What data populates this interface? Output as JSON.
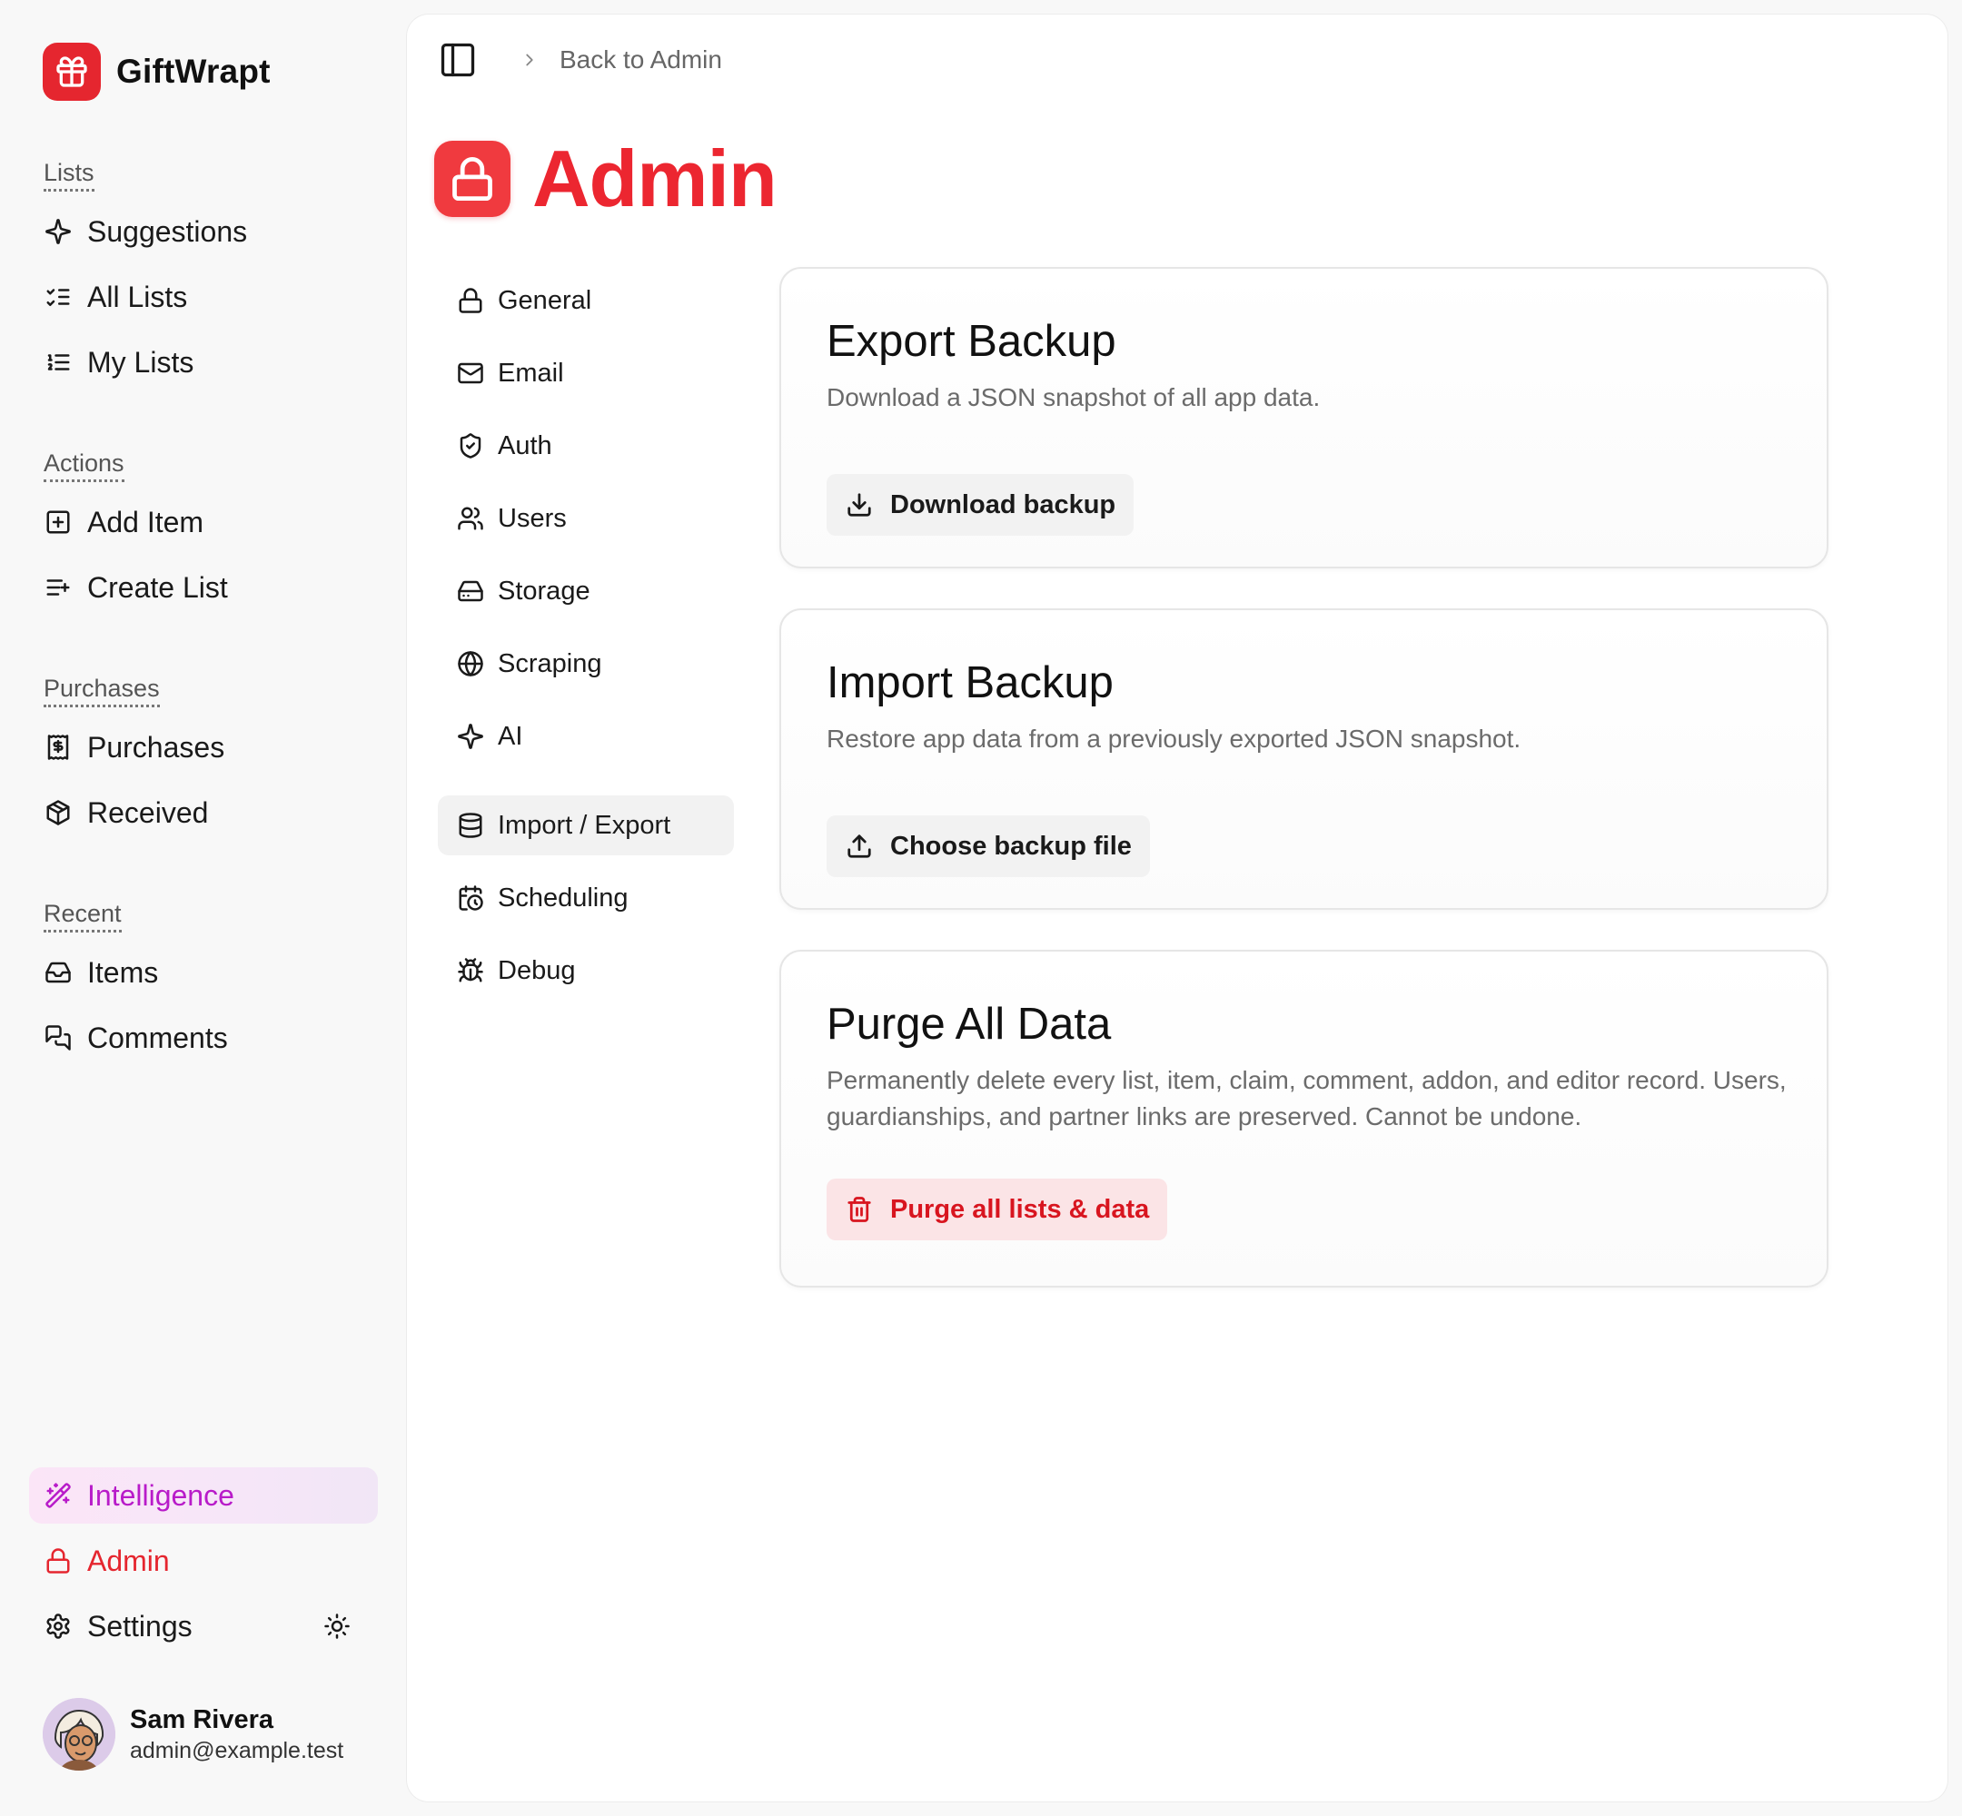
{
  "brand": {
    "name": "GiftWrapt"
  },
  "sidebar": {
    "sections": [
      {
        "label": "Lists",
        "items": [
          {
            "label": "Suggestions",
            "icon": "sparkles-icon"
          },
          {
            "label": "All Lists",
            "icon": "list-checks-icon"
          },
          {
            "label": "My Lists",
            "icon": "list-ordered-icon"
          }
        ]
      },
      {
        "label": "Actions",
        "items": [
          {
            "label": "Add Item",
            "icon": "square-plus-icon"
          },
          {
            "label": "Create List",
            "icon": "list-plus-icon"
          }
        ]
      },
      {
        "label": "Purchases",
        "items": [
          {
            "label": "Purchases",
            "icon": "receipt-icon"
          },
          {
            "label": "Received",
            "icon": "package-icon"
          }
        ]
      },
      {
        "label": "Recent",
        "items": [
          {
            "label": "Items",
            "icon": "inbox-icon"
          },
          {
            "label": "Comments",
            "icon": "messages-icon"
          }
        ]
      }
    ],
    "bottom": {
      "intelligence": "Intelligence",
      "admin": "Admin",
      "settings": "Settings"
    },
    "user": {
      "name": "Sam Rivera",
      "email": "admin@example.test"
    }
  },
  "topbar": {
    "back_label": "Back to Admin"
  },
  "page": {
    "title": "Admin"
  },
  "subnav": {
    "items": [
      {
        "label": "General",
        "icon": "lock-icon"
      },
      {
        "label": "Email",
        "icon": "mail-icon"
      },
      {
        "label": "Auth",
        "icon": "shield-check-icon"
      },
      {
        "label": "Users",
        "icon": "users-icon"
      },
      {
        "label": "Storage",
        "icon": "hard-drive-icon"
      },
      {
        "label": "Scraping",
        "icon": "globe-icon"
      },
      {
        "label": "AI",
        "icon": "sparkles-icon"
      },
      {
        "label": "Import / Export",
        "icon": "database-icon",
        "active": true
      },
      {
        "label": "Scheduling",
        "icon": "calendar-clock-icon"
      },
      {
        "label": "Debug",
        "icon": "bug-icon"
      }
    ]
  },
  "cards": {
    "export": {
      "title": "Export Backup",
      "description": "Download a JSON snapshot of all app data.",
      "button": "Download backup"
    },
    "import": {
      "title": "Import Backup",
      "description": "Restore app data from a previously exported JSON snapshot.",
      "button": "Choose backup file"
    },
    "purge": {
      "title": "Purge All Data",
      "description": "Permanently delete every list, item, claim, comment, addon, and editor record. Users, guardianships, and partner links are preserved. Cannot be undone.",
      "button": "Purge all lists & data"
    }
  },
  "colors": {
    "accent": "#e5262f",
    "intelligence": "#b81bc9",
    "danger_bg": "#fbe4e6"
  }
}
